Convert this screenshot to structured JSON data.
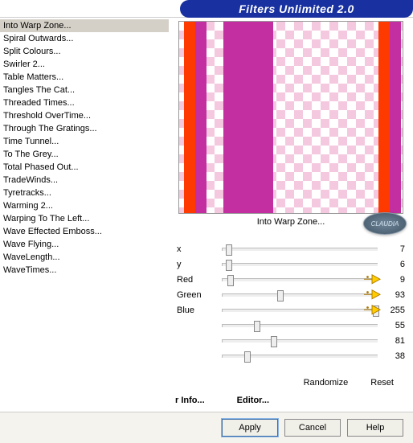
{
  "title": "Filters Unlimited 2.0",
  "filters": [
    {
      "label": "Into Warp Zone...",
      "selected": true
    },
    {
      "label": "Spiral Outwards...",
      "selected": false
    },
    {
      "label": "Split Colours...",
      "selected": false
    },
    {
      "label": "Swirler 2...",
      "selected": false
    },
    {
      "label": "Table Matters...",
      "selected": false
    },
    {
      "label": "Tangles The Cat...",
      "selected": false
    },
    {
      "label": "Threaded Times...",
      "selected": false
    },
    {
      "label": "Threshold OverTime...",
      "selected": false
    },
    {
      "label": "Through The Gratings...",
      "selected": false
    },
    {
      "label": "Time Tunnel...",
      "selected": false
    },
    {
      "label": "To The Grey...",
      "selected": false
    },
    {
      "label": "Total Phased Out...",
      "selected": false
    },
    {
      "label": "TradeWinds...",
      "selected": false
    },
    {
      "label": "Tyretracks...",
      "selected": false
    },
    {
      "label": "Warming 2...",
      "selected": false
    },
    {
      "label": "Warping To The Left...",
      "selected": false
    },
    {
      "label": "Wave Effected Emboss...",
      "selected": false
    },
    {
      "label": "Wave Flying...",
      "selected": false
    },
    {
      "label": "WaveLength...",
      "selected": false
    },
    {
      "label": "WaveTimes...",
      "selected": false
    }
  ],
  "preview_label": "Into Warp Zone...",
  "badge": "CLAUDIA",
  "sliders": [
    {
      "label": "x",
      "value": "7",
      "pointer": false,
      "pos": 2
    },
    {
      "label": "y",
      "value": "6",
      "pointer": false,
      "pos": 2
    },
    {
      "label": "Red",
      "value": "9",
      "pointer": true,
      "pos": 3
    },
    {
      "label": "Green",
      "value": "93",
      "pointer": true,
      "pos": 35
    },
    {
      "label": "Blue",
      "value": "255",
      "pointer": true,
      "pos": 97
    },
    {
      "label": "",
      "value": "55",
      "pointer": false,
      "pos": 20
    },
    {
      "label": "",
      "value": "81",
      "pointer": false,
      "pos": 31
    },
    {
      "label": "",
      "value": "38",
      "pointer": false,
      "pos": 14
    }
  ],
  "controls": {
    "randomize": "Randomize",
    "reset": "Reset"
  },
  "footer": {
    "info": "r Info...",
    "editor": "Editor..."
  },
  "buttons": {
    "apply": "Apply",
    "cancel": "Cancel",
    "help": "Help"
  }
}
